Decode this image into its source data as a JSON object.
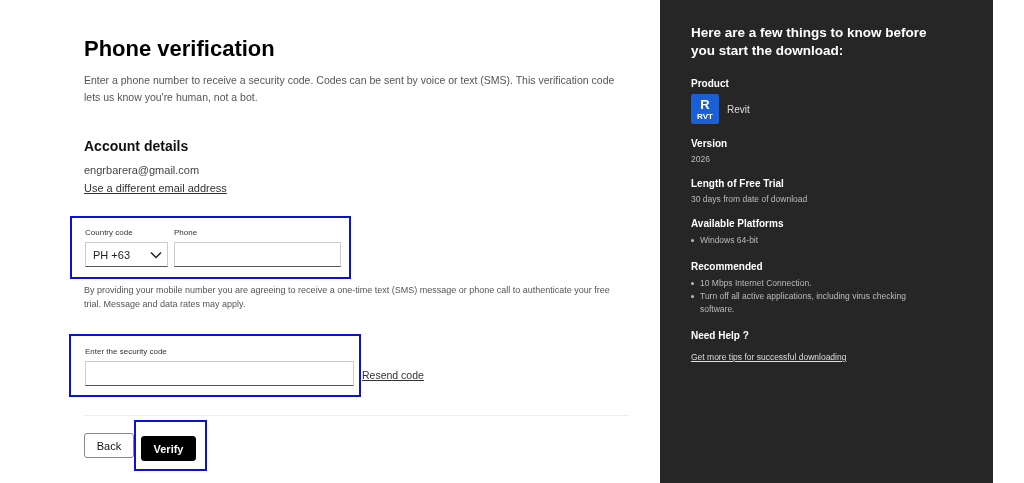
{
  "main": {
    "title": "Phone verification",
    "description": "Enter a phone number to receive a security code. Codes can be sent by voice or text (SMS). This verification code lets us know you're human, not a bot.",
    "account": {
      "heading": "Account details",
      "email": "engrbarera@gmail.com",
      "change_link": "Use a different email address"
    },
    "phone_group": {
      "highlighted": true,
      "country_label": "Country code",
      "country_value": "PH +63",
      "phone_label": "Phone"
    },
    "consent": "By providing your mobile number you are agreeing to receive a one-time text (SMS) message or phone call to authenticate your free trial. Message and data rates may apply.",
    "code_group": {
      "highlighted": true,
      "label": "Enter the security code",
      "resend_link": "Resend code"
    },
    "buttons": [
      {
        "label": "Back",
        "kind": "secondary",
        "highlighted": false
      },
      {
        "label": "Verify",
        "kind": "primary",
        "highlighted": true
      }
    ]
  },
  "sidebar": {
    "heading": "Here are a few things to know before you start the download:",
    "sections": [
      {
        "kind": "product",
        "label": "Product",
        "icon_letter": "R",
        "icon_caption": "RVT",
        "value": "Revit"
      },
      {
        "kind": "text",
        "label": "Version",
        "value": "2026"
      },
      {
        "kind": "text",
        "label": "Length of Free Trial",
        "value": "30 days from date of download"
      },
      {
        "kind": "list",
        "label": "Available Platforms",
        "items": [
          "Windows 64-bit"
        ]
      },
      {
        "kind": "list",
        "label": "Recommended",
        "items": [
          "10 Mbps Internet Connection.",
          "Turn off all active applications, including virus checking software."
        ]
      },
      {
        "kind": "link",
        "label": "Need Help ?",
        "value": "Get more tips for successful downloading"
      }
    ]
  }
}
